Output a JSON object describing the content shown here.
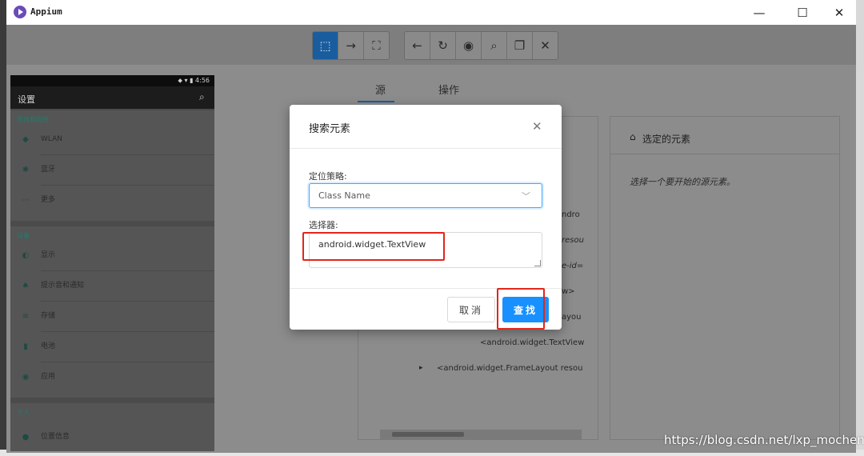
{
  "window": {
    "title": "Appium",
    "controls": {
      "minimize": "—",
      "maximize": "☐",
      "close": "✕"
    }
  },
  "toolbar": {
    "group1": [
      {
        "icon": "select-arrow-icon",
        "glyph": "⬚"
      },
      {
        "icon": "swipe-arrow-icon",
        "glyph": "→"
      },
      {
        "icon": "tap-coordinates-icon",
        "glyph": "⛶"
      }
    ],
    "group2": [
      {
        "icon": "back-arrow-icon",
        "glyph": "←"
      },
      {
        "icon": "refresh-icon",
        "glyph": "↻"
      },
      {
        "icon": "eye-icon",
        "glyph": "◉"
      },
      {
        "icon": "search-icon",
        "glyph": "⌕"
      },
      {
        "icon": "copy-icon",
        "glyph": "❐"
      },
      {
        "icon": "close-icon",
        "glyph": "✕"
      }
    ]
  },
  "device": {
    "status_time": "4:56",
    "status_icons": "⬥ ▾ ▮",
    "appbar_title": "设置",
    "appbar_search": "⌕",
    "sections": [
      {
        "header": "无线和网络",
        "items": [
          {
            "icon": "◆",
            "label": "WLAN"
          },
          {
            "icon": "✱",
            "label": "蓝牙"
          },
          {
            "icon": "⋯",
            "label": "更多"
          }
        ]
      },
      {
        "header": "设备",
        "items": [
          {
            "icon": "◐",
            "label": "显示"
          },
          {
            "icon": "♠",
            "label": "提示音和通知"
          },
          {
            "icon": "≡",
            "label": "存储"
          },
          {
            "icon": "▮",
            "label": "电池"
          },
          {
            "icon": "◉",
            "label": "应用"
          }
        ]
      },
      {
        "header": "个人",
        "items": [
          {
            "icon": "●",
            "label": "位置信息"
          }
        ]
      }
    ]
  },
  "tabs": {
    "source": "源",
    "actions": "操作"
  },
  "source": {
    "lines": [
      "ndro",
      "resou",
      "e-id=",
      "w>",
      "ayou",
      "<android.widget.TextView",
      "<android.widget.FrameLayout resou"
    ],
    "expand_arrow": "▸"
  },
  "selected": {
    "title": "选定的元素",
    "hint": "选择一个要开始的源元素。"
  },
  "modal": {
    "title": "搜索元素",
    "close": "✕",
    "strategy_label": "定位策略:",
    "strategy_value": "Class Name",
    "selector_label": "选择器:",
    "selector_value": "android.widget.TextView",
    "cancel": "取消",
    "search": "查找"
  },
  "watermark": "https://blog.csdn.net/lxp_mocheng"
}
